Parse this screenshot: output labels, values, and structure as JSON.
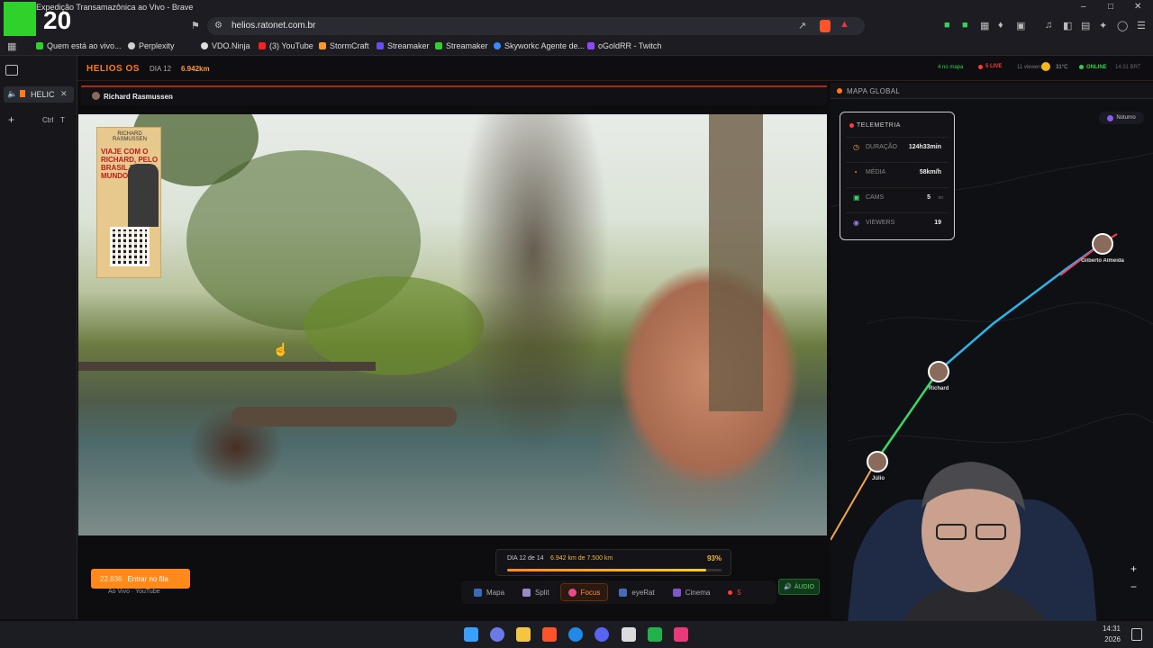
{
  "browser": {
    "window_title": "Expedição Transamazônica ao Vivo - Brave",
    "url": "helios.ratonet.com.br",
    "bookmarks": [
      "Quem está ao vivo...",
      "Perplexity",
      "VDO.Ninja",
      "(3) YouTube",
      "StormCraft",
      "Streamaker",
      "Streamaker",
      "Skyworkc Agente de...",
      "oGoldRR - Twitch"
    ],
    "tab_label": "HELIC",
    "shortcut_ctrl": "Ctrl",
    "shortcut_key": "T"
  },
  "overlay_logo": {
    "number": "20"
  },
  "app": {
    "brand": "HELIOS OS",
    "day": "DIA 12",
    "distance": "6.942km",
    "status": {
      "on_map": "4 no mapa",
      "live": "5 LIVE",
      "viewers": "11 viewers",
      "temperature": "31°C",
      "online": "ONLINE",
      "time": "14:31 BRT"
    }
  },
  "video": {
    "streamer": "Richard Rasmussen",
    "poster_top": "RICHARD RASMUSSEN",
    "poster_text": "VIAJE COM O RICHARD, PELO BRASIL E PELO MUNDO!"
  },
  "progress": {
    "label": "DIA 12 de 14",
    "km": "6.942 km de 7.500 km",
    "percent_text": "93%",
    "percent": 93
  },
  "toolbar": {
    "buttons": [
      "Mapa",
      "Split",
      "Focus",
      "eyeRat",
      "Cinema"
    ],
    "count": "5",
    "audio": "ÁUDIO"
  },
  "join": {
    "label": "Entrar no fila",
    "badge": "22.836",
    "sub": "Ao Vivo · YouTube"
  },
  "map": {
    "title": "MAPA GLOBAL",
    "mode": "Noturno",
    "telemetry": {
      "title": "TELEMETRIA",
      "rows": [
        {
          "label": "DURAÇÃO",
          "value": "124h33min"
        },
        {
          "label": "MÉDIA",
          "value": "58km/h"
        },
        {
          "label": "CAMS",
          "value": "5",
          "unit": "on"
        },
        {
          "label": "VIEWERS",
          "value": "19"
        }
      ]
    },
    "pins": [
      "Richard",
      "Júlio",
      "Gilberto Almeida"
    ],
    "zoom_in": "+",
    "zoom_out": "−"
  },
  "taskbar": {
    "time": "14:31",
    "date": "2026"
  },
  "colors": {
    "accent": "#ff7a1a",
    "live": "#ff3b3b",
    "online": "#2fd24a",
    "route_cyan": "#2fb3e6",
    "route_green": "#36d96a"
  }
}
